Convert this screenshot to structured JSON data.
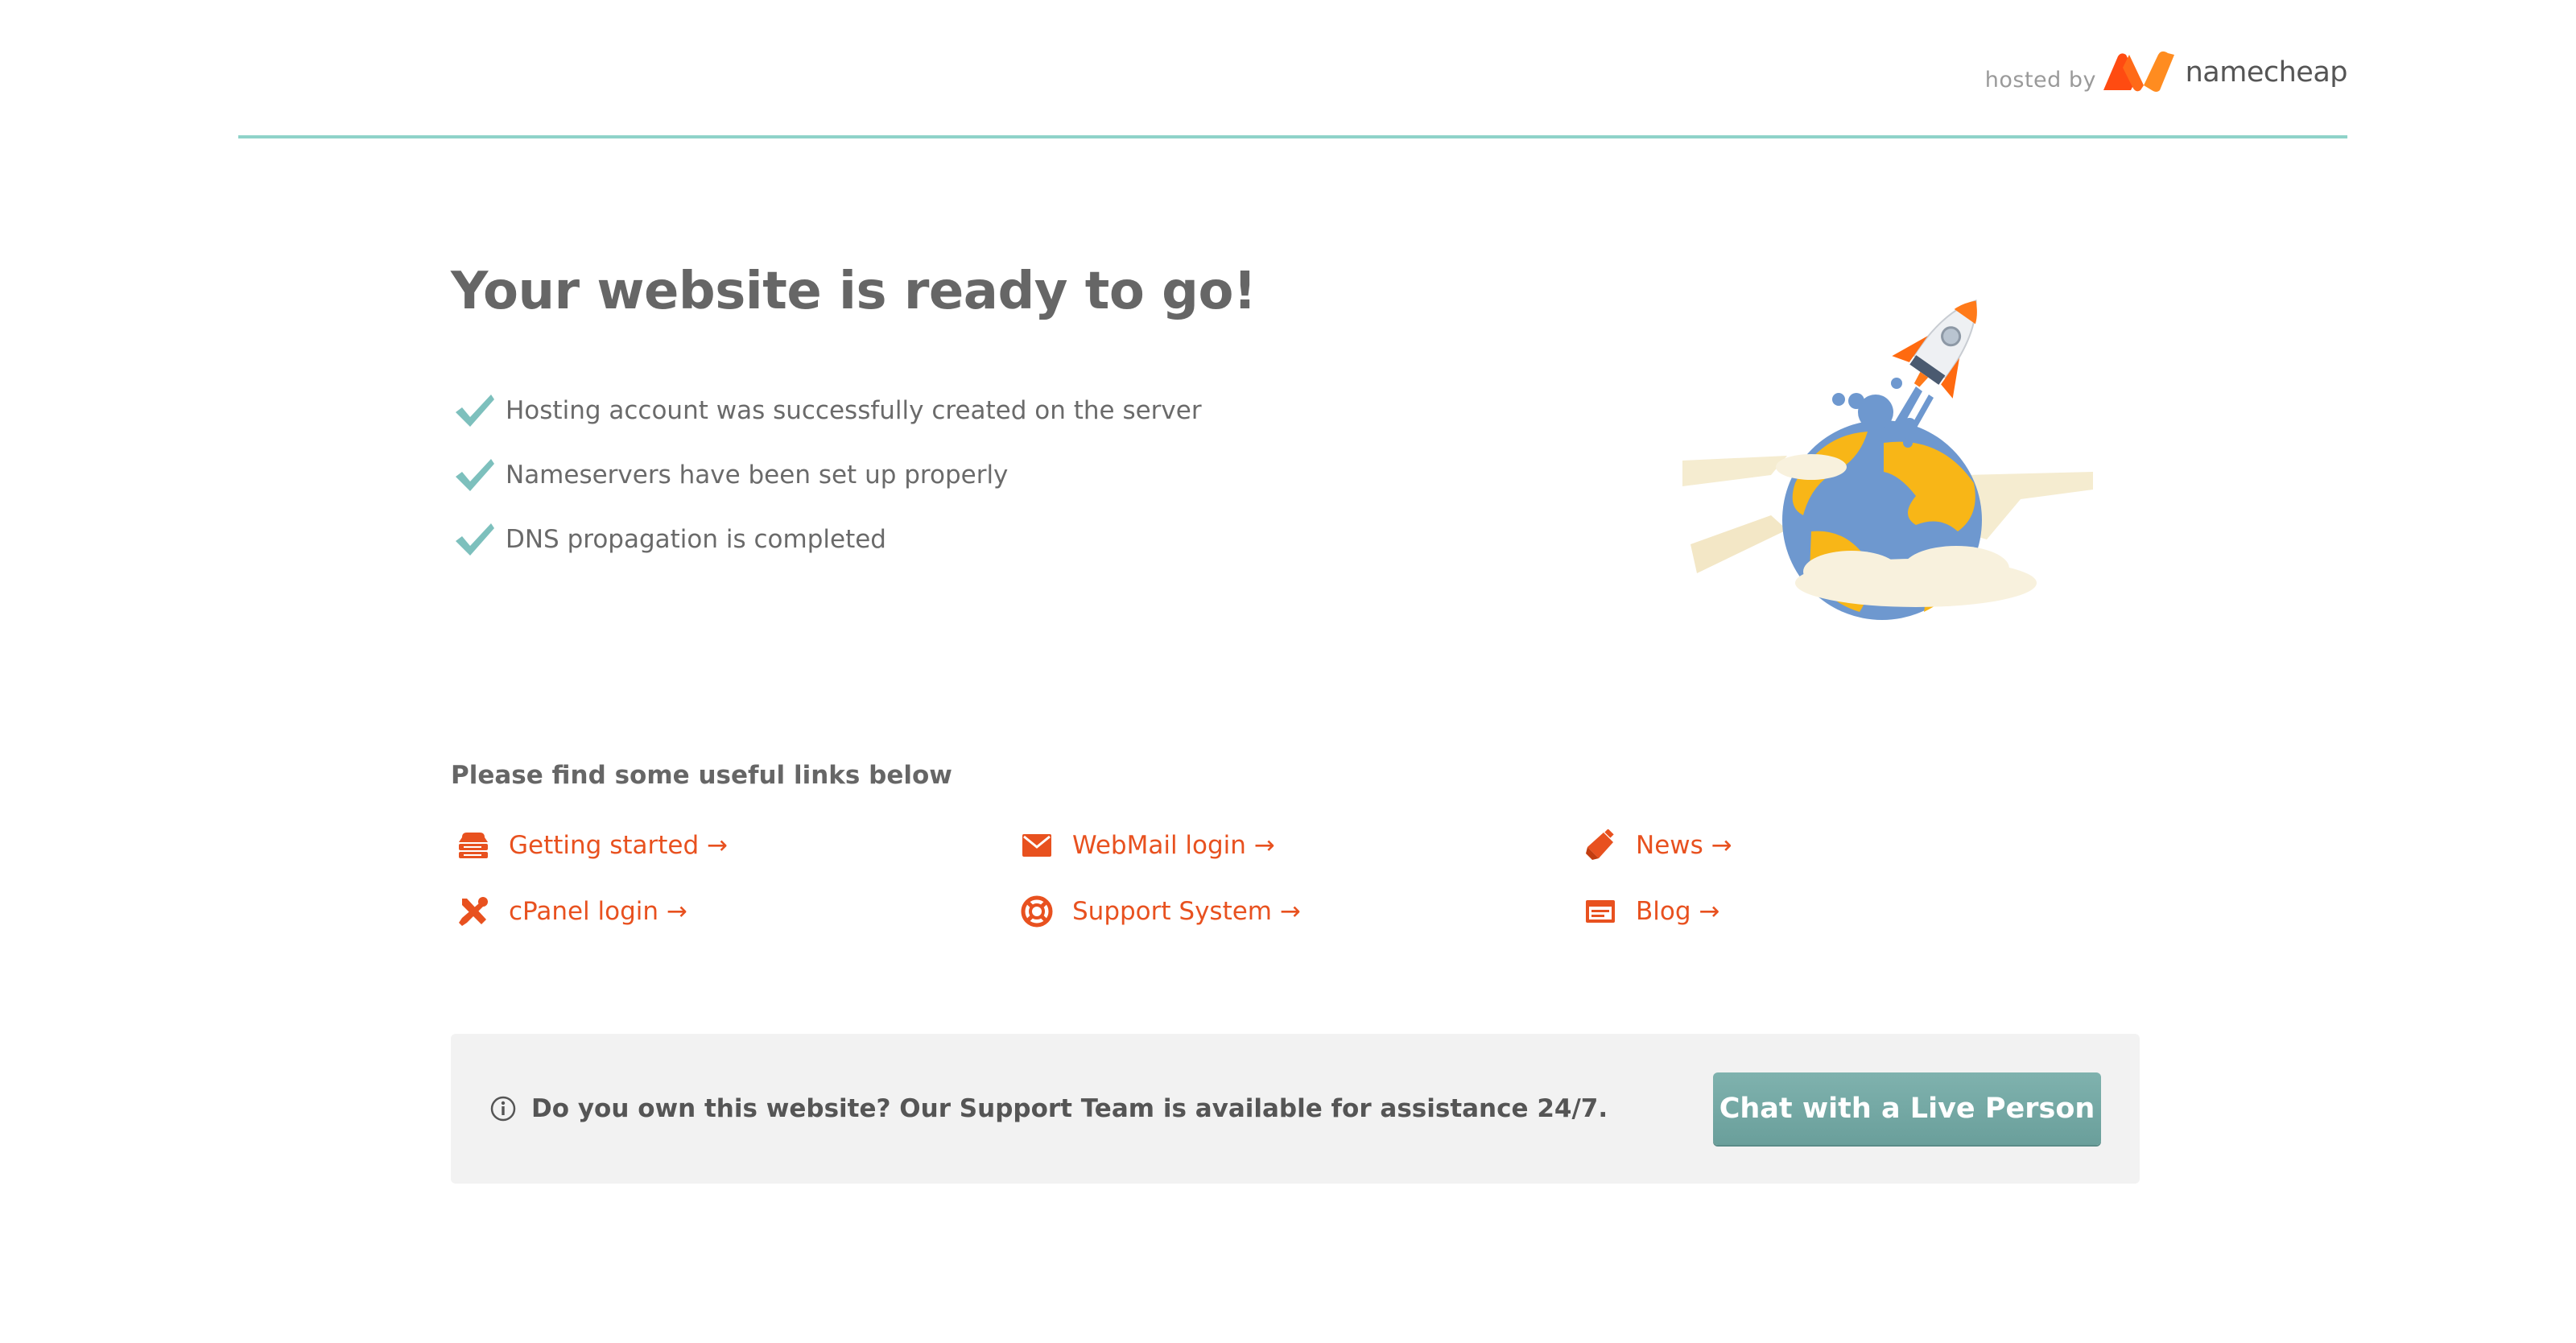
{
  "header": {
    "hosted_by": "hosted by",
    "brand_name": "namecheap",
    "accent_line_color": "#8fd3c9",
    "brand_colors": [
      "#ff4b11",
      "#ff8c20"
    ]
  },
  "main": {
    "title": "Your website is ready to go!",
    "checks": [
      {
        "icon": "check-icon",
        "text": "Hosting account was successfully created on the server"
      },
      {
        "icon": "check-icon",
        "text": "Nameservers have been set up properly"
      },
      {
        "icon": "check-icon",
        "text": "DNS propagation is completed"
      }
    ],
    "check_color": "#7dc0bd"
  },
  "links": {
    "title": "Please find some useful links below",
    "link_color": "#e8511f",
    "items": [
      {
        "icon": "server-icon",
        "label": "Getting started →"
      },
      {
        "icon": "mail-icon",
        "label": "WebMail login →"
      },
      {
        "icon": "megaphone-icon",
        "label": "News →"
      },
      {
        "icon": "tools-icon",
        "label": "cPanel login →"
      },
      {
        "icon": "lifebuoy-icon",
        "label": "Support System →"
      },
      {
        "icon": "browser-window-icon",
        "label": "Blog →"
      }
    ]
  },
  "support": {
    "icon": "info-icon",
    "text": "Do you own this website? Our Support Team is available for assistance 24/7.",
    "button_label": "Chat with a Live Person",
    "button_color": "#73a8a4",
    "bar_color": "#f2f2f2"
  }
}
